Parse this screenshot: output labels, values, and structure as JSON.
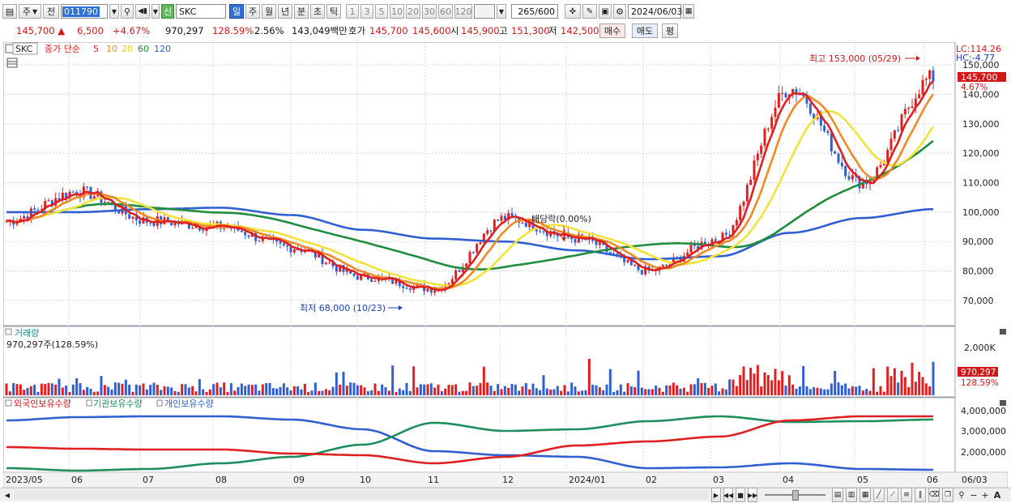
{
  "toolbar": {
    "type_select": "주",
    "prev_button": "전",
    "code_value": "011790",
    "stock_badge": "신",
    "stock_name": "SKC",
    "periods": [
      "일",
      "주",
      "월",
      "년",
      "분",
      "초",
      "틱"
    ],
    "active_period": "일",
    "minute_units": [
      "1",
      "3",
      "5",
      "10",
      "20",
      "30",
      "60",
      "120"
    ],
    "count_current": "265",
    "count_total": "/600",
    "date": "2024/06/03"
  },
  "quote": {
    "price": "145,700",
    "change": "6,500",
    "change_pct": "+4.67%",
    "volume": "970,297",
    "volume_ratio": "128.59%",
    "turnover_pct": "2.56%",
    "amount": "143,049백만",
    "bid_ask_label": "호가",
    "ask": "145,700",
    "bid": "145,600",
    "open_label": "시",
    "open": "145,900",
    "high_label": "고",
    "high": "151,300",
    "low_label": "저",
    "low": "142,500",
    "buy_button": "매수",
    "sell_button": "매도",
    "eval_button": "평"
  },
  "legend": {
    "name": "SKC",
    "series_label": "종가 단순",
    "ma_periods": [
      "5",
      "10",
      "20",
      "60",
      "120"
    ],
    "ma_colors": [
      "#e02020",
      "#f08a24",
      "#e8d21a",
      "#1e8e3e",
      "#2f5fd0"
    ]
  },
  "price_panel": {
    "lc": "LC:114.26",
    "hc": "HC:-4.77",
    "last_price_tag": "145,700",
    "last_pct_tag": "4.67%",
    "high_annotation": "최고 153,000 (05/29)",
    "low_annotation": "최저 68,000 (10/23)",
    "dividend_annotation": "배당락(0.00%)",
    "y_ticks": [
      "150,000",
      "140,000",
      "130,000",
      "120,000",
      "110,000",
      "100,000",
      "90,000",
      "80,000",
      "70,000"
    ]
  },
  "volume_panel": {
    "title": "거래량",
    "value_text": "970,297주(128.59%)",
    "y_tick": "2,000K",
    "last_tag": "970,297",
    "last_pct_tag": "128.59%"
  },
  "holding_panel": {
    "legend": [
      "외국인보유수량",
      "기관보유수량",
      "개인보유수량"
    ],
    "colors": [
      "#e02020",
      "#1e8e5e",
      "#2f5fd0"
    ],
    "y_ticks": [
      "4,000,000",
      "3,000,000",
      "2,000,000"
    ]
  },
  "x_axis": {
    "labels": [
      "2023/05",
      "06",
      "07",
      "08",
      "09",
      "10",
      "11",
      "12",
      "2024/01",
      "02",
      "03",
      "04",
      "05",
      "06"
    ],
    "right_label": "06/03"
  },
  "chart_data": {
    "type": "line",
    "ylim": [
      62000,
      155000
    ],
    "x": [
      "2023/05",
      "06",
      "07",
      "08",
      "09",
      "10",
      "11",
      "12",
      "2024/01",
      "02",
      "03",
      "04",
      "05",
      "06"
    ],
    "series": [
      {
        "name": "종가",
        "values": [
          97000,
          107000,
          97000,
          95000,
          88000,
          78000,
          74000,
          98000,
          91000,
          80000,
          91000,
          142000,
          110000,
          145700
        ]
      },
      {
        "name": "5",
        "values": [
          97000,
          105000,
          98000,
          96000,
          89000,
          80000,
          73000,
          97000,
          91000,
          80000,
          89000,
          138000,
          110000,
          140000
        ]
      },
      {
        "name": "120",
        "values": [
          100000,
          100000,
          101000,
          101500,
          99000,
          94000,
          91000,
          90000,
          87000,
          84000,
          85000,
          93000,
          98000,
          101000
        ]
      }
    ]
  }
}
